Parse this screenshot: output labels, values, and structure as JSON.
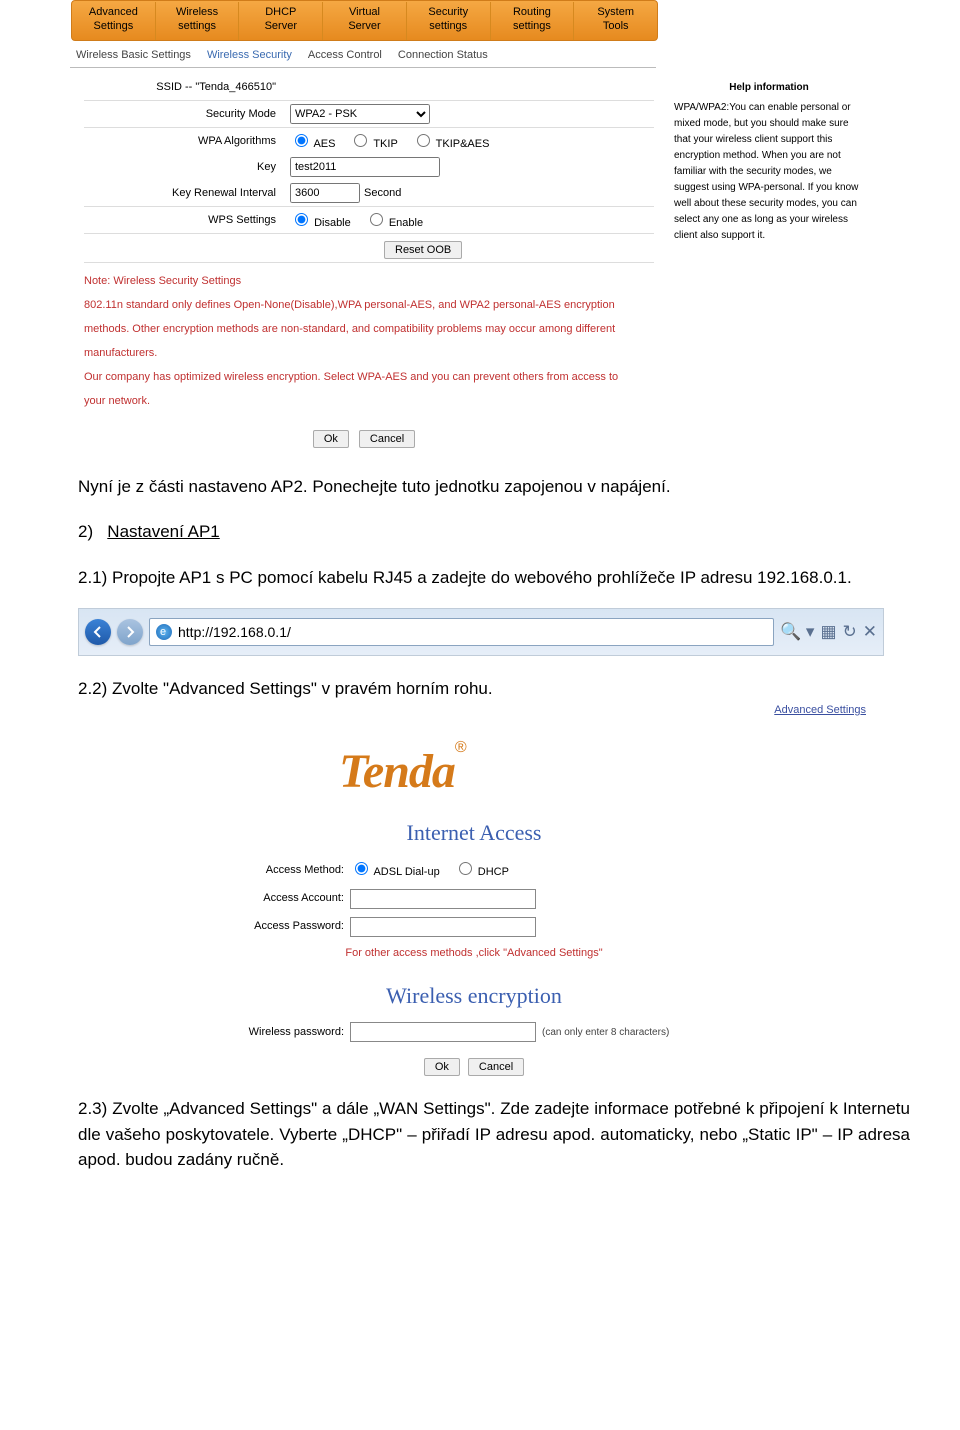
{
  "router": {
    "nav": [
      {
        "l1": "Advanced",
        "l2": "Settings"
      },
      {
        "l1": "Wireless",
        "l2": "settings"
      },
      {
        "l1": "DHCP",
        "l2": "Server"
      },
      {
        "l1": "Virtual",
        "l2": "Server"
      },
      {
        "l1": "Security",
        "l2": "settings"
      },
      {
        "l1": "Routing",
        "l2": "settings"
      },
      {
        "l1": "System",
        "l2": "Tools"
      }
    ],
    "subnav": [
      "Wireless Basic Settings",
      "Wireless Security",
      "Access Control",
      "Connection Status"
    ],
    "ssid_label": "SSID -- \"Tenda_466510\"",
    "secmode_label": "Security Mode",
    "secmode_value": "WPA2 - PSK",
    "alg_label": "WPA Algorithms",
    "alg_aes": "AES",
    "alg_tkip": "TKIP",
    "alg_both": "TKIP&AES",
    "key_label": "Key",
    "key_value": "test2011",
    "renew_label": "Key Renewal Interval",
    "renew_value": "3600",
    "renew_unit": "Second",
    "wps_label": "WPS Settings",
    "wps_disable": "Disable",
    "wps_enable": "Enable",
    "reset_oob": "Reset OOB",
    "note_title": "Note: Wireless Security Settings",
    "note_body": "802.11n standard only defines Open-None(Disable),WPA personal-AES, and WPA2 personal-AES encryption methods. Other encryption methods are non-standard, and compatibility problems may occur among different manufacturers.",
    "note_body2": "Our company has optimized wireless encryption. Select WPA-AES and you can prevent others from access to your network.",
    "ok": "Ok",
    "cancel": "Cancel",
    "help_title": "Help information",
    "help_body": "WPA/WPA2:You can enable personal or mixed mode, but you should make sure that your wireless client support this encryption method. When you are not familiar with the security modes, we suggest using WPA-personal. If you know well about these security modes, you can select any one as long as your wireless client also support it."
  },
  "doc": {
    "p1": "Nyní je z části nastaveno AP2. Ponechejte tuto jednotku zapojenou v napájení.",
    "head2": "Nastavení AP1",
    "head2num": "2)",
    "s21": "2.1)  Propojte AP1 s PC pomocí kabelu RJ45 a zadejte do webového prohlížeče IP adresu 192.168.0.1.",
    "url": "http://192.168.0.1/",
    "s22": "2.2)  Zvolte \"Advanced Settings\" v pravém horním rohu.",
    "advlink": "Advanced Settings",
    "s23": "2.3)  Zvolte „Advanced Settings\" a dále „WAN Settings\". Zde zadejte informace potřebné k připojení k Internetu dle vašeho poskytovatele. Vyberte „DHCP\" – přiřadí IP adresu apod. automaticky, nebo „Static IP\" – IP adresa apod. budou zadány ručně."
  },
  "simple": {
    "ia_head": "Internet Access",
    "am_label": "Access Method:",
    "adsl": "ADSL Dial-up",
    "dhcp": "DHCP",
    "acc_label": "Access Account:",
    "pwd_label": "Access Password:",
    "redhint": "For other access methods ,click \"Advanced Settings\"",
    "we_head": "Wireless encryption",
    "wp_label": "Wireless password:",
    "wp_hint": "(can only enter 8 characters)",
    "ok": "Ok",
    "cancel": "Cancel"
  }
}
